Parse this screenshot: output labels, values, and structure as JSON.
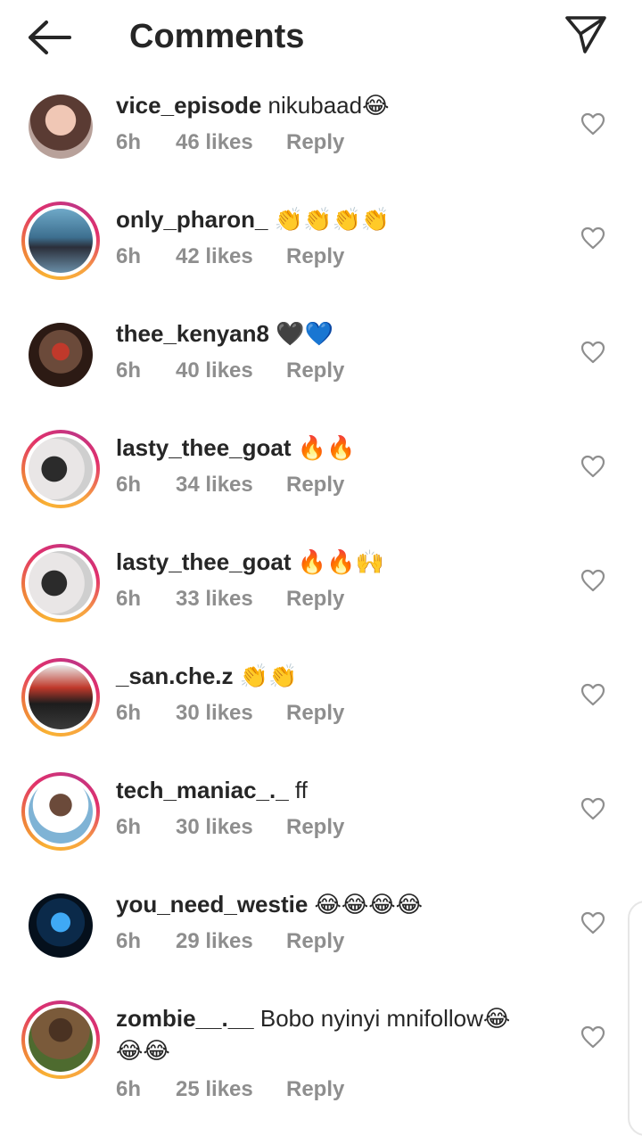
{
  "header": {
    "title": "Comments",
    "back_icon": "arrow-left-icon",
    "share_icon": "send-paper-plane-icon"
  },
  "colors": {
    "story_ring": [
      "#f9b233",
      "#e1306c",
      "#c13584"
    ],
    "meta_text": "#8e8e8e",
    "text": "#262626"
  },
  "comments": [
    {
      "username": "vice_episode",
      "text": " nikubaad😂",
      "time": "6h",
      "likes": "46 likes",
      "reply": "Reply",
      "ring": false
    },
    {
      "username": "only_pharon_",
      "text": " 👏👏👏👏",
      "time": "6h",
      "likes": "42 likes",
      "reply": "Reply",
      "ring": true
    },
    {
      "username": "thee_kenyan8",
      "text": " 🖤💙",
      "time": "6h",
      "likes": "40 likes",
      "reply": "Reply",
      "ring": false
    },
    {
      "username": "lasty_thee_goat",
      "text": " 🔥🔥",
      "time": "6h",
      "likes": "34 likes",
      "reply": "Reply",
      "ring": true
    },
    {
      "username": "lasty_thee_goat",
      "text": " 🔥🔥🙌",
      "time": "6h",
      "likes": "33 likes",
      "reply": "Reply",
      "ring": true
    },
    {
      "username": "_san.che.z",
      "text": " 👏👏",
      "time": "6h",
      "likes": "30 likes",
      "reply": "Reply",
      "ring": true
    },
    {
      "username": "tech_maniac_._",
      "text": " ff",
      "time": "6h",
      "likes": "30 likes",
      "reply": "Reply",
      "ring": true
    },
    {
      "username": "you_need_westie",
      "text": " 😂😂😂😂",
      "time": "6h",
      "likes": "29 likes",
      "reply": "Reply",
      "ring": false
    },
    {
      "username": "zombie__.__",
      "text": " Bobo nyinyi mnifollow😂",
      "text2": "😂😂",
      "time": "6h",
      "likes": "25 likes",
      "reply": "Reply",
      "ring": true
    }
  ]
}
